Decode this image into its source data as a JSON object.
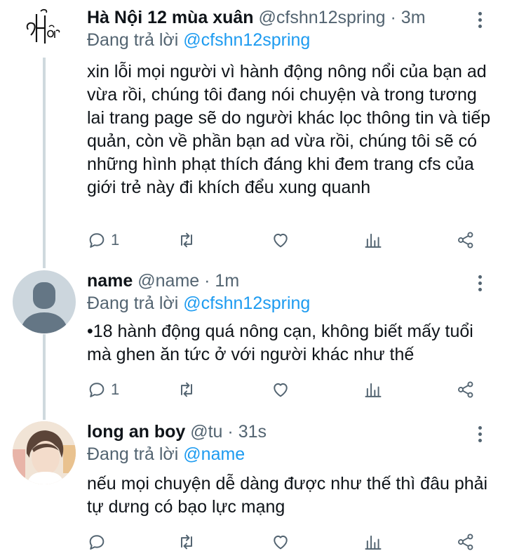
{
  "tweets": [
    {
      "name": "Hà Nội 12 mùa xuân",
      "handle": "@cfshn12spring",
      "sep": "·",
      "time": "3m",
      "reply_prefix": "Đang trả lời",
      "reply_to": "@cfshn12spring",
      "text": "xin lỗi mọi người vì hành động nông nổi của bạn ad vừa rồi, chúng tôi đang nói chuyện và trong tương lai trang page sẽ do người khác lọc thông tin và tiếp quản, còn về phần bạn ad vừa rồi, chúng tôi sẽ có những hình phạt thích đáng khi đem trang cfs của giới trẻ này đi khích đểu xung quanh",
      "reply_count": "1",
      "avatar": "calligraphy-logo"
    },
    {
      "name": "name",
      "handle": "@name",
      "sep": "·",
      "time": "1m",
      "reply_prefix": "Đang trả lời",
      "reply_to": "@cfshn12spring",
      "text": "•18 hành động quá nông cạn, không biết mấy tuổi mà ghen ăn tức ở với người khác như thế",
      "reply_count": "1",
      "avatar": "default-avatar"
    },
    {
      "name": "long an boy",
      "handle": "@tu",
      "sep": "·",
      "time": "31s",
      "reply_prefix": "Đang trả lời",
      "reply_to": "@name",
      "text": "nếu mọi chuyện dễ dàng được như thế thì đâu phải tự dưng có bạo lực mạng",
      "reply_count": "",
      "avatar": "photo-avatar"
    }
  ],
  "colors": {
    "text": "#0f1419",
    "muted": "#536471",
    "link": "#1d9bf0",
    "line": "#cfd9de"
  },
  "icons": [
    "reply-icon",
    "retweet-icon",
    "like-icon",
    "analytics-icon",
    "share-icon",
    "more-icon"
  ]
}
